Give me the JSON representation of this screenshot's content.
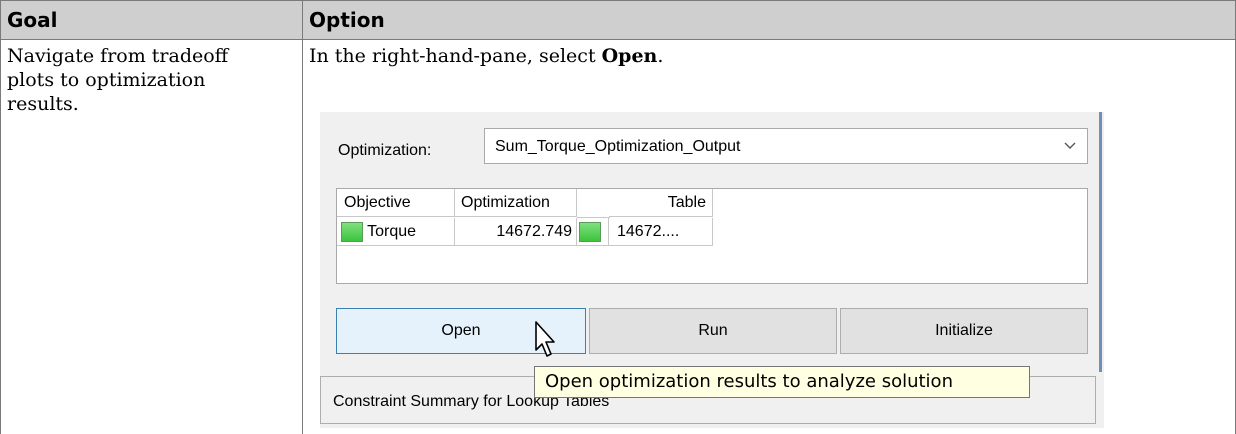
{
  "table": {
    "headers": {
      "goal": "Goal",
      "option": "Option"
    },
    "row": {
      "goal_lines": [
        "Navigate from tradeoff",
        "plots to optimization",
        "results."
      ],
      "option_intro_prefix": "In the right-hand-pane, select ",
      "option_intro_bold": "Open",
      "option_intro_suffix": "."
    }
  },
  "app": {
    "optimization_label": "Optimization:",
    "optimization_value": "Sum_Torque_Optimization_Output",
    "grid": {
      "columns": [
        "Objective",
        "Optimization",
        "",
        "Table"
      ],
      "rows": [
        {
          "objective": "Torque",
          "optimization": "14672.749",
          "table": "14672...."
        }
      ]
    },
    "buttons": {
      "open": "Open",
      "run": "Run",
      "initialize": "Initialize"
    },
    "tab_label": "Constraint Summary for Lookup Tables",
    "tooltip": "Open optimization results to analyze solution"
  },
  "colors": {
    "status_green": "#3cc33c",
    "tooltip_bg": "#ffffe1",
    "header_bg": "#cfcfcf"
  },
  "icons": [
    "chevron-down-icon",
    "status-swatch-icon",
    "mouse-pointer-icon"
  ]
}
